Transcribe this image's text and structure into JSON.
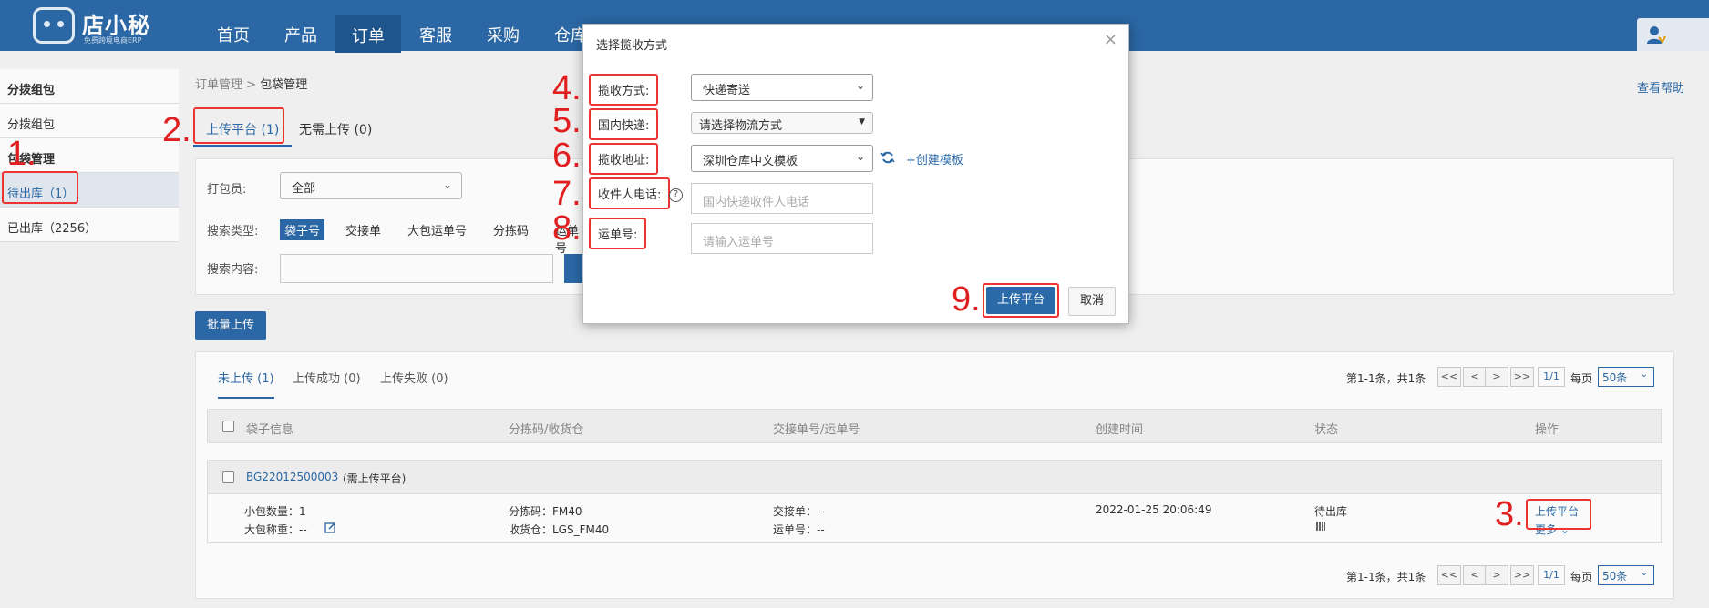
{
  "app": {
    "logo_text": "店小秘",
    "logo_subtitle": "免费跨境电商ERP",
    "nav": [
      "首页",
      "产品",
      "订单",
      "客服",
      "采购",
      "仓库"
    ],
    "active_nav": "订单"
  },
  "sidebar": {
    "sections": [
      {
        "header": "分拨组包",
        "items": [
          "分拨组包"
        ]
      },
      {
        "header": "包袋管理",
        "items": [
          "待出库（1）",
          "已出库（2256）"
        ]
      }
    ]
  },
  "breadcrumb": {
    "parent": "订单管理",
    "separator": ">",
    "current": "包袋管理"
  },
  "help_link": "查看帮助",
  "top_tabs": [
    "上传平台 (1)",
    "无需上传 (0)"
  ],
  "filters": {
    "packer_label": "打包员:",
    "packer_value": "全部",
    "search_type_label": "搜索类型:",
    "search_types": [
      "袋子号",
      "交接单",
      "大包运单号",
      "分拣码",
      "运单号"
    ],
    "search_content_label": "搜索内容:"
  },
  "batch_upload_button": "批量上传",
  "list": {
    "tabs": [
      "未上传 (1)",
      "上传成功 (0)",
      "上传失败 (0)"
    ],
    "pagination": {
      "summary": "第1-1条，共1条",
      "buttons": [
        "<<",
        "<",
        ">",
        ">>"
      ],
      "page": "1/1",
      "per_page_label": "每页",
      "per_page_value": "50条"
    },
    "columns": [
      "袋子信息",
      "分拣码/收货仓",
      "交接单号/运单号",
      "创建时间",
      "状态",
      "操作"
    ],
    "row": {
      "bag_no": "BG22012500003",
      "bag_note": "(需上传平台)",
      "small_pkg_count": "小包数量：1",
      "big_pkg_weight": "大包称重：--",
      "sort_code": "分拣码：FM40",
      "warehouse": "收货仓：LGS_FM40",
      "handover": "交接单：--",
      "waybill": "运单号：--",
      "created": "2022-01-25 20:06:49",
      "status": "待出库",
      "action_upload": "上传平台",
      "action_more": "更多"
    }
  },
  "modal": {
    "title": "选择揽收方式",
    "fields": {
      "pickup_method_label": "揽收方式:",
      "pickup_method_value": "快递寄送",
      "domestic_express_label": "国内快递:",
      "domestic_express_value": "请选择物流方式",
      "pickup_address_label": "揽收地址:",
      "pickup_address_value": "深圳仓库中文模板",
      "create_template_link": "+创建模板",
      "recipient_phone_label": "收件人电话:",
      "recipient_phone_placeholder": "国内快递收件人电话",
      "waybill_label": "运单号:",
      "waybill_placeholder": "请输入运单号"
    },
    "submit_button": "上传平台",
    "cancel_button": "取消"
  },
  "annotations": [
    "1.",
    "2.",
    "3.",
    "4.",
    "5.",
    "6.",
    "7.",
    "8.",
    "9."
  ],
  "colors": {
    "nav_bg": "#2b6aa8",
    "accent": "#2b6aa8",
    "annotation_red": "#e02020"
  }
}
